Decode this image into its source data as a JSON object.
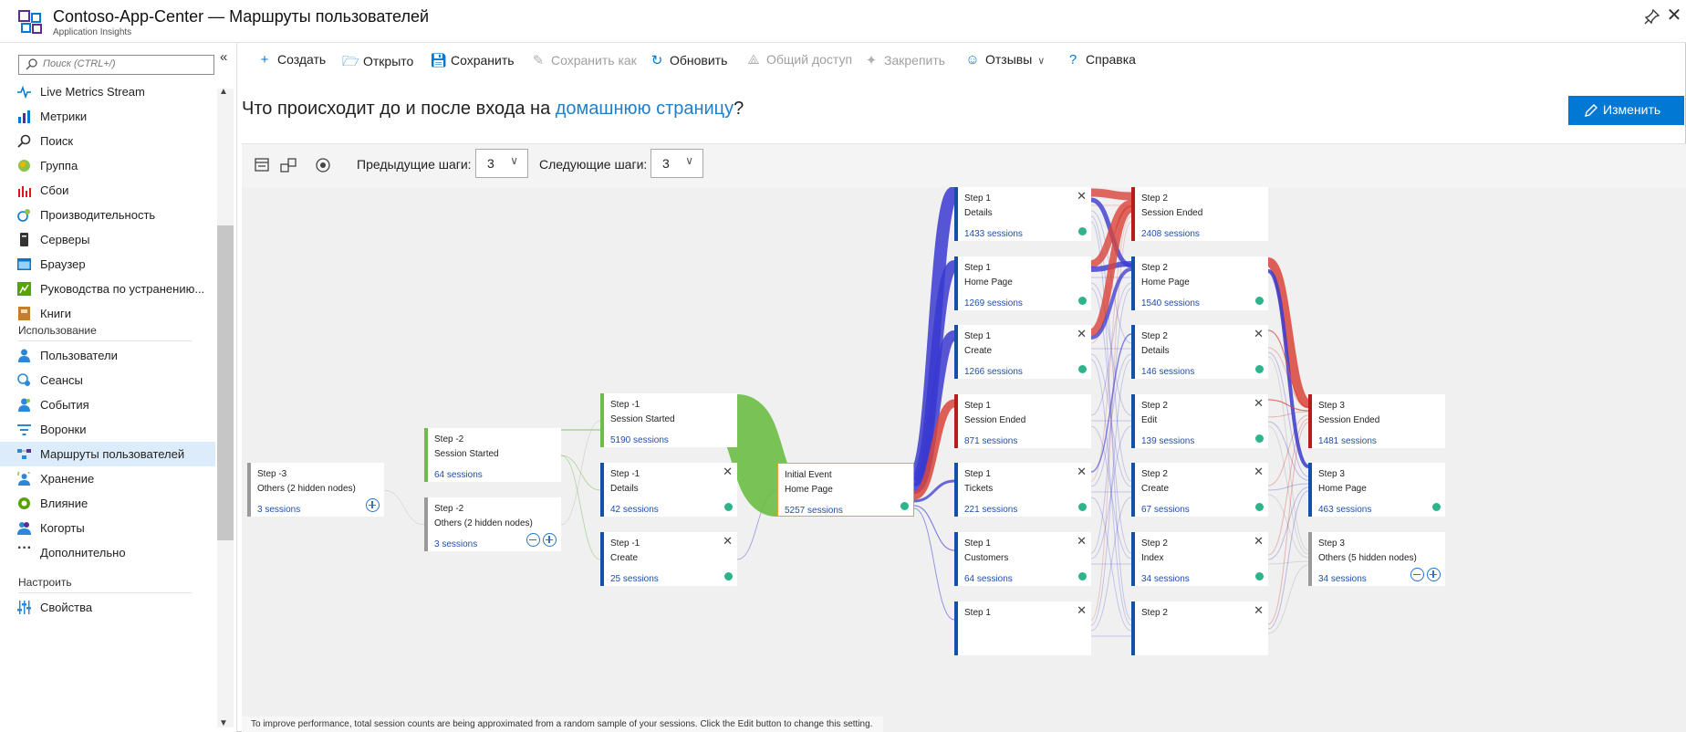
{
  "window": {
    "title": "Contoso-App-Center — Маршруты пользователей",
    "subtitle": "Application Insights"
  },
  "sidebar": {
    "search_placeholder": "Поиск (CTRL+/)",
    "items": [
      {
        "label": "Live Metrics Stream",
        "icon": "pulse-icon"
      },
      {
        "label": "Метрики",
        "icon": "metrics-icon"
      },
      {
        "label": "Поиск",
        "icon": "search-icon"
      },
      {
        "label": "Группа",
        "icon": "globe-icon"
      },
      {
        "label": "Сбои",
        "icon": "failures-icon"
      },
      {
        "label": "Производительность",
        "icon": "performance-icon"
      },
      {
        "label": "Серверы",
        "icon": "server-icon"
      },
      {
        "label": "Браузер",
        "icon": "browser-icon"
      },
      {
        "label": "Руководства по устранению...",
        "icon": "troubleshoot-icon"
      },
      {
        "label": "Книги",
        "icon": "workbook-icon"
      }
    ],
    "usage_section": "Использование",
    "usage_items": [
      {
        "label": "Пользователи",
        "icon": "users-icon"
      },
      {
        "label": "Сеансы",
        "icon": "sessions-icon"
      },
      {
        "label": "События",
        "icon": "events-icon"
      },
      {
        "label": "Воронки",
        "icon": "funnel-icon"
      },
      {
        "label": "Маршруты пользователей",
        "icon": "user-flows-icon",
        "active": true
      },
      {
        "label": "Хранение",
        "icon": "retention-icon"
      },
      {
        "label": "Влияние",
        "icon": "impact-icon"
      },
      {
        "label": "Когорты",
        "icon": "cohorts-icon"
      },
      {
        "label": "Дополнительно",
        "icon": "more-icon"
      }
    ],
    "configure_section": "Настроить",
    "configure_items": [
      {
        "label": "Свойства",
        "icon": "properties-icon"
      }
    ]
  },
  "toolbar": {
    "create": "Создать",
    "open": "Открыто",
    "save": "Сохранить",
    "save_as": "Сохранить как",
    "refresh": "Обновить",
    "share": "Общий доступ",
    "pin": "Закрепить",
    "feedback": "Отзывы",
    "help": "Справка"
  },
  "question": {
    "prefix": "Что происходит до и после входа на ",
    "link": "домашнюю страницу",
    "suffix": "?"
  },
  "edit_button": "Изменить",
  "controls": {
    "prev_label": "Предыдущие шаги:",
    "prev_value": "3",
    "next_label": "Следующие шаги:",
    "next_value": "3"
  },
  "footer_note": "To improve performance, total session counts are being approximated from a random sample of your sessions. Click the Edit button to change this setting.",
  "colors": {
    "accent": "#0078d4",
    "link_blue": "#3a3ad0",
    "link_red": "#d9443a",
    "link_green": "#6cbc45",
    "start_node_border": "#6cbc45",
    "initial_node_border": "#f0a030",
    "ended_node_border": "#b71c1c",
    "others_node_border": "#9a9a9a",
    "dot_green": "#2eb38a"
  },
  "nodes": [
    {
      "id": "s3_others",
      "step": "Step -3",
      "name": "Others (2 hidden nodes)",
      "sessions": "3 sessions",
      "kind": "others",
      "controls": "plus"
    },
    {
      "id": "s2_started",
      "step": "Step -2",
      "name": "Session Started",
      "sessions": "64 sessions",
      "kind": "start"
    },
    {
      "id": "s2_others",
      "step": "Step -2",
      "name": "Others (2 hidden nodes)",
      "sessions": "3 sessions",
      "kind": "others",
      "controls": "minusplus"
    },
    {
      "id": "s1_started",
      "step": "Step -1",
      "name": "Session Started",
      "sessions": "5190 sessions",
      "kind": "start"
    },
    {
      "id": "s1_details",
      "step": "Step -1",
      "name": "Details",
      "sessions": "42 sessions",
      "kind": "normal",
      "x": true,
      "dot": true
    },
    {
      "id": "s1_create",
      "step": "Step -1",
      "name": "Create",
      "sessions": "25 sessions",
      "kind": "normal",
      "x": true,
      "dot": true
    },
    {
      "id": "init",
      "step": "Initial Event",
      "name": "Home Page",
      "sessions": "5257 sessions",
      "kind": "initial",
      "dot": true
    },
    {
      "id": "a_details",
      "step": "Step 1",
      "name": "Details",
      "sessions": "1433 sessions",
      "kind": "normal",
      "x": true,
      "dot": true
    },
    {
      "id": "a_home",
      "step": "Step 1",
      "name": "Home Page",
      "sessions": "1269 sessions",
      "kind": "normal",
      "dot": true
    },
    {
      "id": "a_create",
      "step": "Step 1",
      "name": "Create",
      "sessions": "1266 sessions",
      "kind": "normal",
      "x": true,
      "dot": true
    },
    {
      "id": "a_ended",
      "step": "Step 1",
      "name": "Session Ended",
      "sessions": "871 sessions",
      "kind": "ended"
    },
    {
      "id": "a_tickets",
      "step": "Step 1",
      "name": "Tickets",
      "sessions": "221 sessions",
      "kind": "normal",
      "x": true,
      "dot": true
    },
    {
      "id": "a_customers",
      "step": "Step 1",
      "name": "Customers",
      "sessions": "64 sessions",
      "kind": "normal",
      "x": true,
      "dot": true
    },
    {
      "id": "a_more",
      "step": "Step 1",
      "name": "",
      "sessions": "",
      "kind": "normal",
      "x": true
    },
    {
      "id": "b_ended",
      "step": "Step 2",
      "name": "Session Ended",
      "sessions": "2408 sessions",
      "kind": "ended"
    },
    {
      "id": "b_home",
      "step": "Step 2",
      "name": "Home Page",
      "sessions": "1540 sessions",
      "kind": "normal",
      "dot": true
    },
    {
      "id": "b_details",
      "step": "Step 2",
      "name": "Details",
      "sessions": "146 sessions",
      "kind": "normal",
      "x": true,
      "dot": true
    },
    {
      "id": "b_edit",
      "step": "Step 2",
      "name": "Edit",
      "sessions": "139 sessions",
      "kind": "normal",
      "x": true,
      "dot": true
    },
    {
      "id": "b_create",
      "step": "Step 2",
      "name": "Create",
      "sessions": "67 sessions",
      "kind": "normal",
      "x": true,
      "dot": true
    },
    {
      "id": "b_index",
      "step": "Step 2",
      "name": "Index",
      "sessions": "34 sessions",
      "kind": "normal",
      "x": true,
      "dot": true
    },
    {
      "id": "b_more",
      "step": "Step 2",
      "name": "",
      "sessions": "",
      "kind": "normal",
      "x": true
    },
    {
      "id": "c_ended",
      "step": "Step 3",
      "name": "Session Ended",
      "sessions": "1481 sessions",
      "kind": "ended"
    },
    {
      "id": "c_home",
      "step": "Step 3",
      "name": "Home Page",
      "sessions": "463 sessions",
      "kind": "normal",
      "dot": true
    },
    {
      "id": "c_others",
      "step": "Step 3",
      "name": "Others (5 hidden nodes)",
      "sessions": "34 sessions",
      "kind": "others",
      "controls": "minusplus"
    }
  ]
}
